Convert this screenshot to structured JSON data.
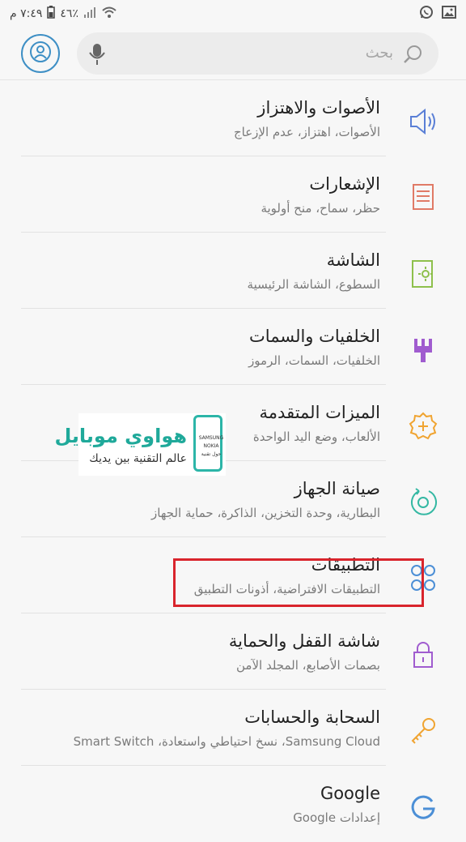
{
  "status_bar": {
    "time": "٧:٤٩ م",
    "battery": "٤٦٪",
    "left_icons": [
      "whatsapp-icon",
      "gallery-icon"
    ],
    "right_icons": [
      "battery-icon",
      "signal-icon",
      "wifi-icon"
    ]
  },
  "search": {
    "placeholder": "بحث"
  },
  "settings": [
    {
      "title": "الأصوات والاهتزاز",
      "subtitle": "الأصوات، اهتزاز، عدم الإزعاج",
      "icon": "volume-icon",
      "color": "#5a7fd6"
    },
    {
      "title": "الإشعارات",
      "subtitle": "حظر، سماح، منح أولوية",
      "icon": "notifications-icon",
      "color": "#e07a66"
    },
    {
      "title": "الشاشة",
      "subtitle": "السطوع، الشاشة الرئيسية",
      "icon": "display-icon",
      "color": "#8ec04c"
    },
    {
      "title": "الخلفيات والسمات",
      "subtitle": "الخلفيات، السمات، الرموز",
      "icon": "brush-icon",
      "color": "#a05ccf"
    },
    {
      "title": "الميزات المتقدمة",
      "subtitle": "الألعاب، وضع اليد الواحدة",
      "icon": "gear-plus-icon",
      "color": "#f0a431"
    },
    {
      "title": "صيانة الجهاز",
      "subtitle": "البطارية، وحدة التخزين، الذاكرة، حماية الجهاز",
      "icon": "device-care-icon",
      "color": "#34b8a3"
    },
    {
      "title": "التطبيقات",
      "subtitle": "التطبيقات الافتراضية، أذونات التطبيق",
      "icon": "apps-icon",
      "color": "#4c8fd6"
    },
    {
      "title": "شاشة القفل والحماية",
      "subtitle": "بصمات الأصابع، المجلد الآمن",
      "icon": "lock-icon",
      "color": "#a05ccf"
    },
    {
      "title": "السحابة والحسابات",
      "subtitle": "Samsung Cloud، نسخ احتياطي واستعادة، Smart Switch",
      "icon": "key-icon",
      "color": "#f0a431"
    },
    {
      "title": "Google",
      "subtitle": "إعدادات Google",
      "icon": "google-icon",
      "color": "#4c8fd6"
    }
  ],
  "watermark": {
    "title": "هواوي موبايل",
    "subtitle": "عالم التقنية بين يديك",
    "brands": [
      "SAMSUNG",
      "NOKIA",
      "حول تقنية"
    ]
  },
  "highlight_color": "#d9242c"
}
